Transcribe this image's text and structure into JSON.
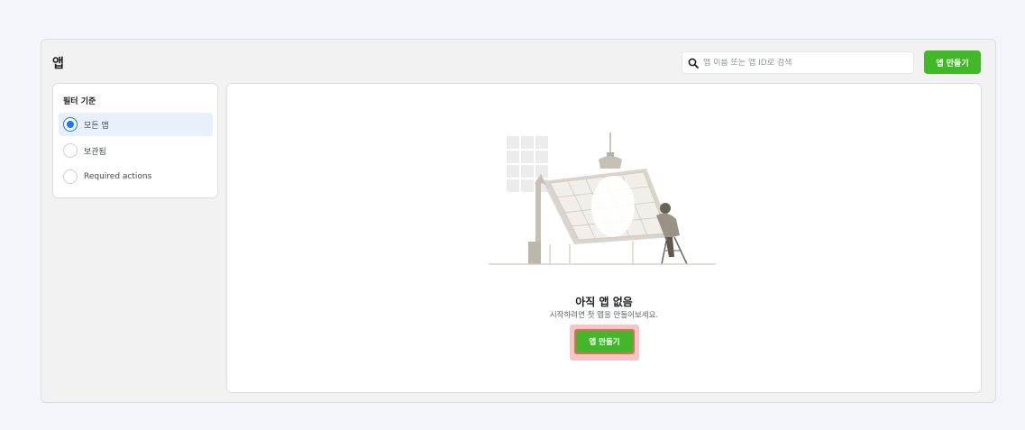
{
  "header": {
    "title": "앱",
    "search_placeholder": "앱 이름 또는 앱 ID로 검색",
    "create_button_label": "앱 만들기"
  },
  "filter": {
    "title": "필터 기준",
    "options": [
      {
        "label": "모든 앱",
        "selected": true
      },
      {
        "label": "보관됨",
        "selected": false
      },
      {
        "label": "Required actions",
        "selected": false
      }
    ]
  },
  "empty_state": {
    "title": "아직 앱 없음",
    "subtitle": "시작하려면 첫 앱을 만들어보세요.",
    "create_button_label": "앱 만들기"
  },
  "colors": {
    "accent_green": "#42b72a",
    "selected_blue": "#1877f2",
    "highlight": "#f6c6c6"
  },
  "icons": {
    "search": "magnifier-icon",
    "illustration": "empty-apps-illustration"
  }
}
